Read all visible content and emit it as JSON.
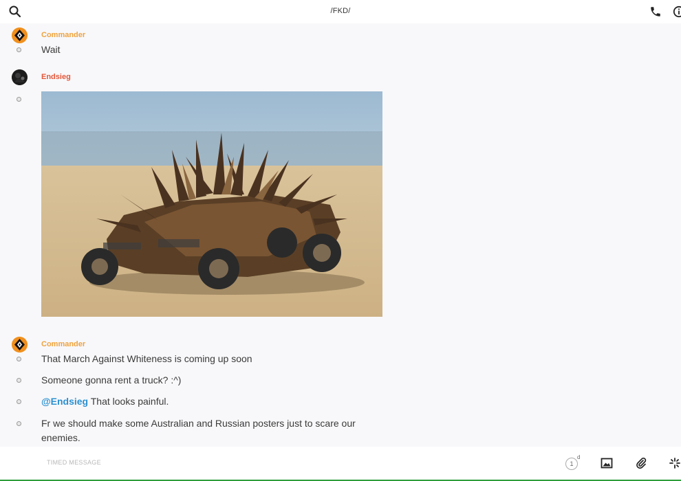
{
  "header": {
    "title": "/FKD/",
    "search_icon": "search-icon",
    "call_icon": "phone-icon",
    "info_icon": "info-icon"
  },
  "messages": [
    {
      "sender": "Commander",
      "avatar": "commander-avatar",
      "text": "Wait"
    },
    {
      "sender": "Endsieg",
      "avatar": "endsieg-avatar",
      "attachment": "photo-attachment"
    },
    {
      "sender": "Commander",
      "avatar": "commander-avatar",
      "lines": [
        {
          "text": "That March Against Whiteness is coming up soon"
        },
        {
          "text": "Someone gonna rent a truck? :^)"
        },
        {
          "mention": "@Endsieg",
          "text": " That looks painful."
        },
        {
          "text": "Fr we should make some Australian and Russian posters just to scare our enemies."
        }
      ]
    }
  ],
  "composer": {
    "placeholder": "TIMED MESSAGE",
    "timer_value": "1",
    "timer_unit": "d",
    "icons": [
      "timer-icon",
      "image-icon",
      "paperclip-icon",
      "sparkle-icon"
    ]
  },
  "colors": {
    "commander": "#f0a23c",
    "endsieg": "#e3573a",
    "mention": "#2c90d0",
    "bottom_accent": "#2e9d3a"
  }
}
